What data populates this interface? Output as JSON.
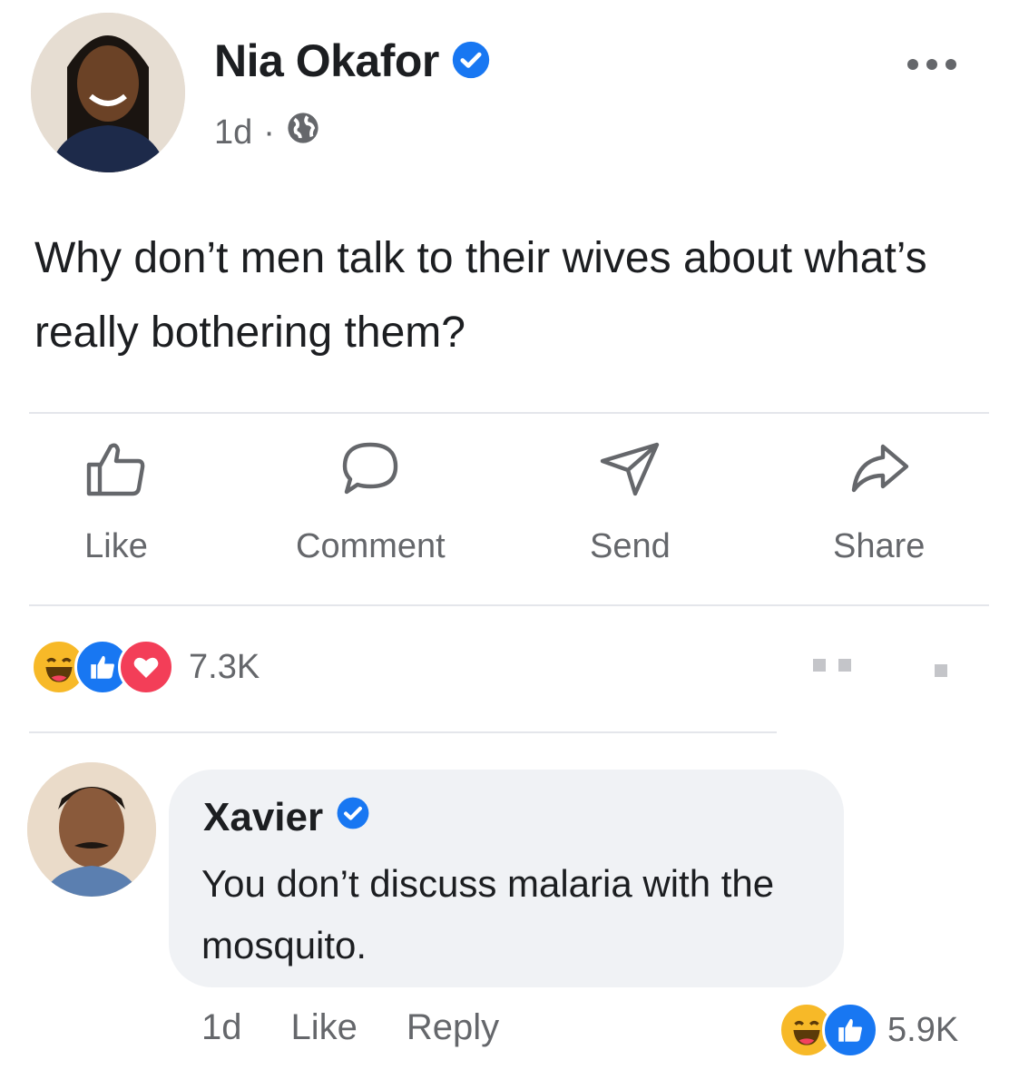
{
  "post": {
    "author_name": "Nia Okafor",
    "timestamp": "1d",
    "separator": "·",
    "audience_icon": "globe-icon",
    "body": "Why don’t men talk to their wives about what’s really bothering them?"
  },
  "actions": {
    "like": "Like",
    "comment": "Comment",
    "send": "Send",
    "share": "Share"
  },
  "reactions": {
    "types": [
      "haha",
      "like",
      "love"
    ],
    "count": "7.3K"
  },
  "comment": {
    "author_name": "Xavier",
    "text": "You don’t discuss malaria with the mosquito.",
    "timestamp": "1d",
    "like_label": "Like",
    "reply_label": "Reply",
    "reaction_types": [
      "haha",
      "like"
    ],
    "reaction_count": "5.9K"
  },
  "colors": {
    "verified_blue": "#1877f2",
    "love_red": "#f33e58",
    "haha_yellow": "#f7b928",
    "secondary_text": "#65676b",
    "bubble_bg": "#f0f2f5"
  }
}
